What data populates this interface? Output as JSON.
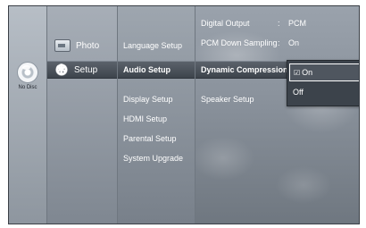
{
  "disc": {
    "label": "No Disc",
    "icon": "disc-icon"
  },
  "main_menu": [
    {
      "label": "Photo",
      "icon": "photo-icon"
    },
    {
      "label": "Setup",
      "icon": "gear-icon"
    }
  ],
  "sub_menu": [
    {
      "label": "Language Setup"
    },
    {
      "label": "Audio Setup"
    },
    {
      "label": "Display Setup"
    },
    {
      "label": "HDMI Setup"
    },
    {
      "label": "Parental Setup"
    },
    {
      "label": "System Upgrade"
    }
  ],
  "audio_options": [
    {
      "label": "Digital Output",
      "colon": ":",
      "value": "PCM"
    },
    {
      "label": "PCM Down Sampling",
      "colon": ":",
      "value": "On"
    },
    {
      "label": "Dynamic Compression",
      "colon": "",
      "value": ""
    },
    {
      "label": "Speaker Setup",
      "colon": "",
      "value": ""
    }
  ],
  "dropdown": {
    "items": [
      {
        "label": "On",
        "check": "☑"
      },
      {
        "label": "Off",
        "check": ""
      }
    ]
  },
  "colors": {
    "accent": "#4f565f",
    "text": "#ffffff",
    "panel": "#3c434b"
  }
}
